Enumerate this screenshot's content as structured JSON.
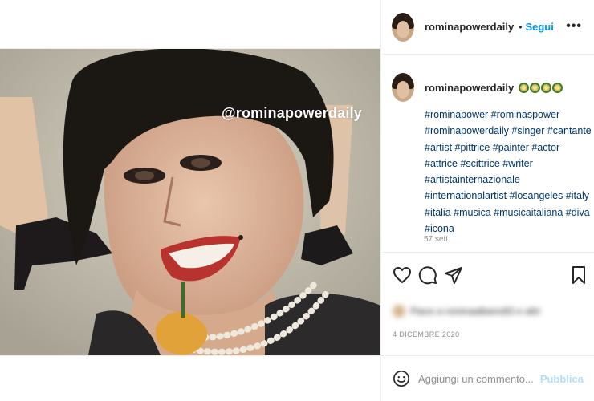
{
  "post": {
    "watermark": "@rominapowerdaily"
  },
  "header": {
    "username": "rominapowerdaily",
    "separator": "•",
    "follow_label": "Segui",
    "more_label": "•••"
  },
  "caption": {
    "username": "rominapowerdaily",
    "emoji_icon": "sunflower-icon",
    "hashtags": "#rominapower #rominaspower #rominapowerdaily #singer #cantante #artist #pittrice #painter #actor #attrice #scittrice #writer #artistainternazionale #internationalartist #losangeles #italy #italia #musica #musicaitaliana #diva #icona",
    "time": "57 sett."
  },
  "actions": {
    "like_icon": "heart-icon",
    "comment_icon": "comment-icon",
    "share_icon": "paper-plane-icon",
    "save_icon": "bookmark-icon"
  },
  "likes": {
    "text": "Piace a rominaalbano83 e altri"
  },
  "date": "4 DICEMBRE 2020",
  "comment": {
    "placeholder": "Aggiungi un commento...",
    "publish_label": "Pubblica"
  },
  "colors": {
    "link": "#00376b",
    "accent": "#0095f6",
    "publish_disabled": "#b2dffc",
    "muted": "#8e8e8e"
  }
}
